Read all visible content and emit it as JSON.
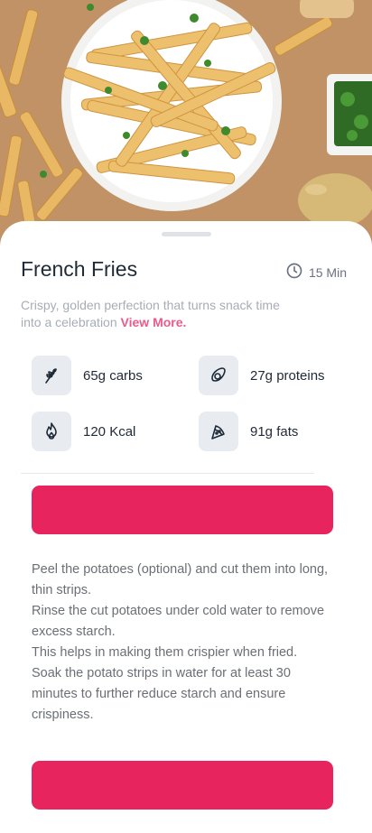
{
  "recipe": {
    "title": "French Fries",
    "time": "15 Min",
    "description": "Crispy, golden perfection that turns snack time into a celebration",
    "view_more": "View More."
  },
  "nutrition": [
    {
      "label": "65g carbs",
      "icon": "wheat-icon"
    },
    {
      "label": "27g proteins",
      "icon": "avocado-icon"
    },
    {
      "label": "120 Kcal",
      "icon": "flame-icon"
    },
    {
      "label": "91g fats",
      "icon": "pizza-icon"
    }
  ],
  "instructions": [
    "Peel the potatoes (optional) and cut them into long, thin strips.",
    "Rinse the cut potatoes under cold water to remove excess starch.",
    "This helps in making them crispier when fried.",
    "Soak the potato strips in water for at least 30 minutes to further reduce starch and ensure crispiness."
  ],
  "colors": {
    "accent": "#e8245e",
    "link": "#ea5a8a",
    "title": "#1f2a37",
    "icon_bg": "#e8ecf1"
  }
}
